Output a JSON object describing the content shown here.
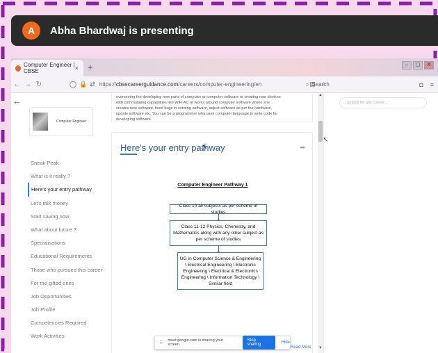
{
  "meet": {
    "avatar_letter": "A",
    "presenting_text": "Abha Bhardwaj is presenting",
    "accent_color": "#f06a1d"
  },
  "browser": {
    "tab_title": "Computer Engineer | CBSE",
    "tab_close": "×",
    "new_tab": "+",
    "url_prefix": "https://",
    "url_domain": "cbsecareerguidance.com",
    "url_path": "/careers/computer-engineering/en",
    "search_label": "Search",
    "win_min": "–",
    "win_max": "▢",
    "win_close": "X"
  },
  "sidebar_card": {
    "label": "Computer Engineer"
  },
  "sidebar": {
    "items": [
      {
        "label": "Sneak Peak",
        "active": false
      },
      {
        "label": "What is it really ?",
        "active": false
      },
      {
        "label": "Here's your entry pathway",
        "active": true
      },
      {
        "label": "Let's talk money",
        "active": false
      },
      {
        "label": "Start saving now",
        "active": false
      },
      {
        "label": "What about future ?",
        "active": false
      },
      {
        "label": "Specialisations",
        "active": false
      },
      {
        "label": "Educational Requirements",
        "active": false
      },
      {
        "label": "Those who pursued this career",
        "active": false
      },
      {
        "label": "For the gifted ones",
        "active": false
      },
      {
        "label": "Job Opportunities",
        "active": false
      },
      {
        "label": "Job Profile",
        "active": false
      },
      {
        "label": "Competencies Required",
        "active": false
      },
      {
        "label": "Work Activities",
        "active": false
      }
    ]
  },
  "intro": {
    "line1": "overseeing the developing new parts of computer or computer software or creating new devices",
    "line2": "with commutating capabilities like WiFi AC or works around computer software where she",
    "line3": "creates new software, fixed bugs in existing software, adjust software as per the hardware,",
    "line4": "update software etc. You can be a programmer who uses computer language to write code for",
    "line5": "developing software."
  },
  "pathway": {
    "title": "Here's your entry pathway",
    "diagram_title": "Computer Engineer Pathway 1",
    "steps": [
      "Class 10 all subjects as per scheme of studies",
      "Class 11-12 Physics, Chemistry, and Mathematics along with any other subject as per scheme of studies",
      "UG in Computer Science & Engineering \\ Electrical Engineering \\ Electronic Engineering \\ Electrical & Electronics Engineering \\ Information Technology \\ Similar field"
    ],
    "dots_total": 9,
    "active_dot": 0
  },
  "right_panel": {
    "search_placeholder": "Search for any Career..."
  },
  "share_bar": {
    "grip": "⠿",
    "message": "meet.google.com is sharing your screen.",
    "stop_label": "Stop sharing",
    "hide_label": "Hide"
  },
  "read_more": "Read More"
}
